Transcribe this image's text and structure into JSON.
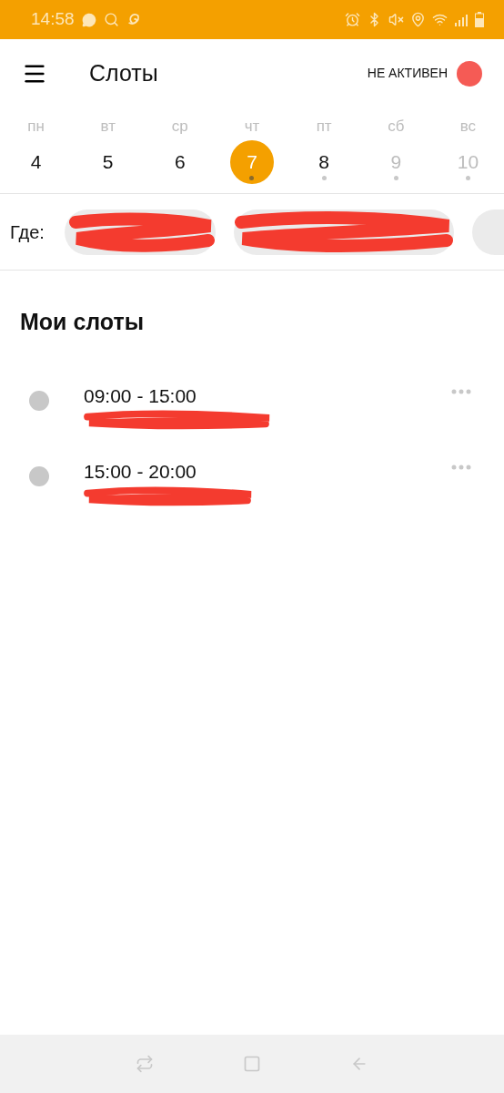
{
  "status_bar": {
    "time": "14:58"
  },
  "header": {
    "title": "Слоты",
    "status": {
      "label": "НЕ АКТИВЕН",
      "active": false
    }
  },
  "days": [
    {
      "weekday": "пн",
      "date": "4",
      "selected": false,
      "disabled": false,
      "has_slots": false
    },
    {
      "weekday": "вт",
      "date": "5",
      "selected": false,
      "disabled": false,
      "has_slots": false
    },
    {
      "weekday": "ср",
      "date": "6",
      "selected": false,
      "disabled": false,
      "has_slots": false
    },
    {
      "weekday": "чт",
      "date": "7",
      "selected": true,
      "disabled": false,
      "has_slots": true
    },
    {
      "weekday": "пт",
      "date": "8",
      "selected": false,
      "disabled": false,
      "has_slots": true
    },
    {
      "weekday": "сб",
      "date": "9",
      "selected": false,
      "disabled": true,
      "has_slots": true
    },
    {
      "weekday": "вс",
      "date": "10",
      "selected": false,
      "disabled": true,
      "has_slots": true
    }
  ],
  "location": {
    "label": "Где:"
  },
  "section_title": "Мои слоты",
  "slots": [
    {
      "time": "09:00 - 15:00"
    },
    {
      "time": "15:00 - 20:00"
    }
  ]
}
